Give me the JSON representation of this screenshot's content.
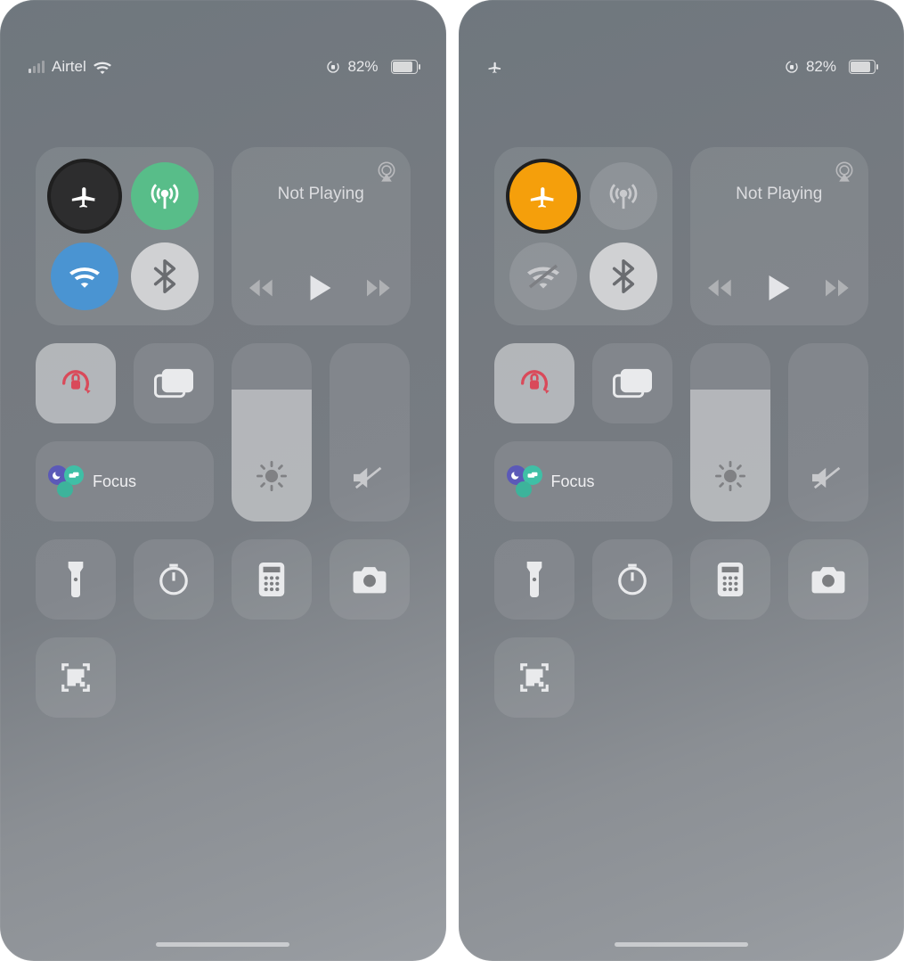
{
  "left": {
    "status": {
      "carrier": "Airtel",
      "battery": "82%",
      "airplane_mode": false
    },
    "connectivity": {
      "airplane": {
        "name": "airplane-icon",
        "on": false
      },
      "cellular": {
        "name": "antenna-icon",
        "on": true
      },
      "wifi": {
        "name": "wifi-icon",
        "on": true
      },
      "bluetooth": {
        "name": "bluetooth-icon",
        "on": true
      }
    },
    "media": {
      "title": "Not Playing"
    },
    "focus_label": "Focus"
  },
  "right": {
    "status": {
      "battery": "82%",
      "airplane_mode": true
    },
    "connectivity": {
      "airplane": {
        "name": "airplane-icon",
        "on": true
      },
      "cellular": {
        "name": "antenna-icon",
        "on": false
      },
      "wifi": {
        "name": "wifi-off-icon",
        "on": false
      },
      "bluetooth": {
        "name": "bluetooth-icon",
        "on": true
      }
    },
    "media": {
      "title": "Not Playing"
    },
    "focus_label": "Focus"
  }
}
